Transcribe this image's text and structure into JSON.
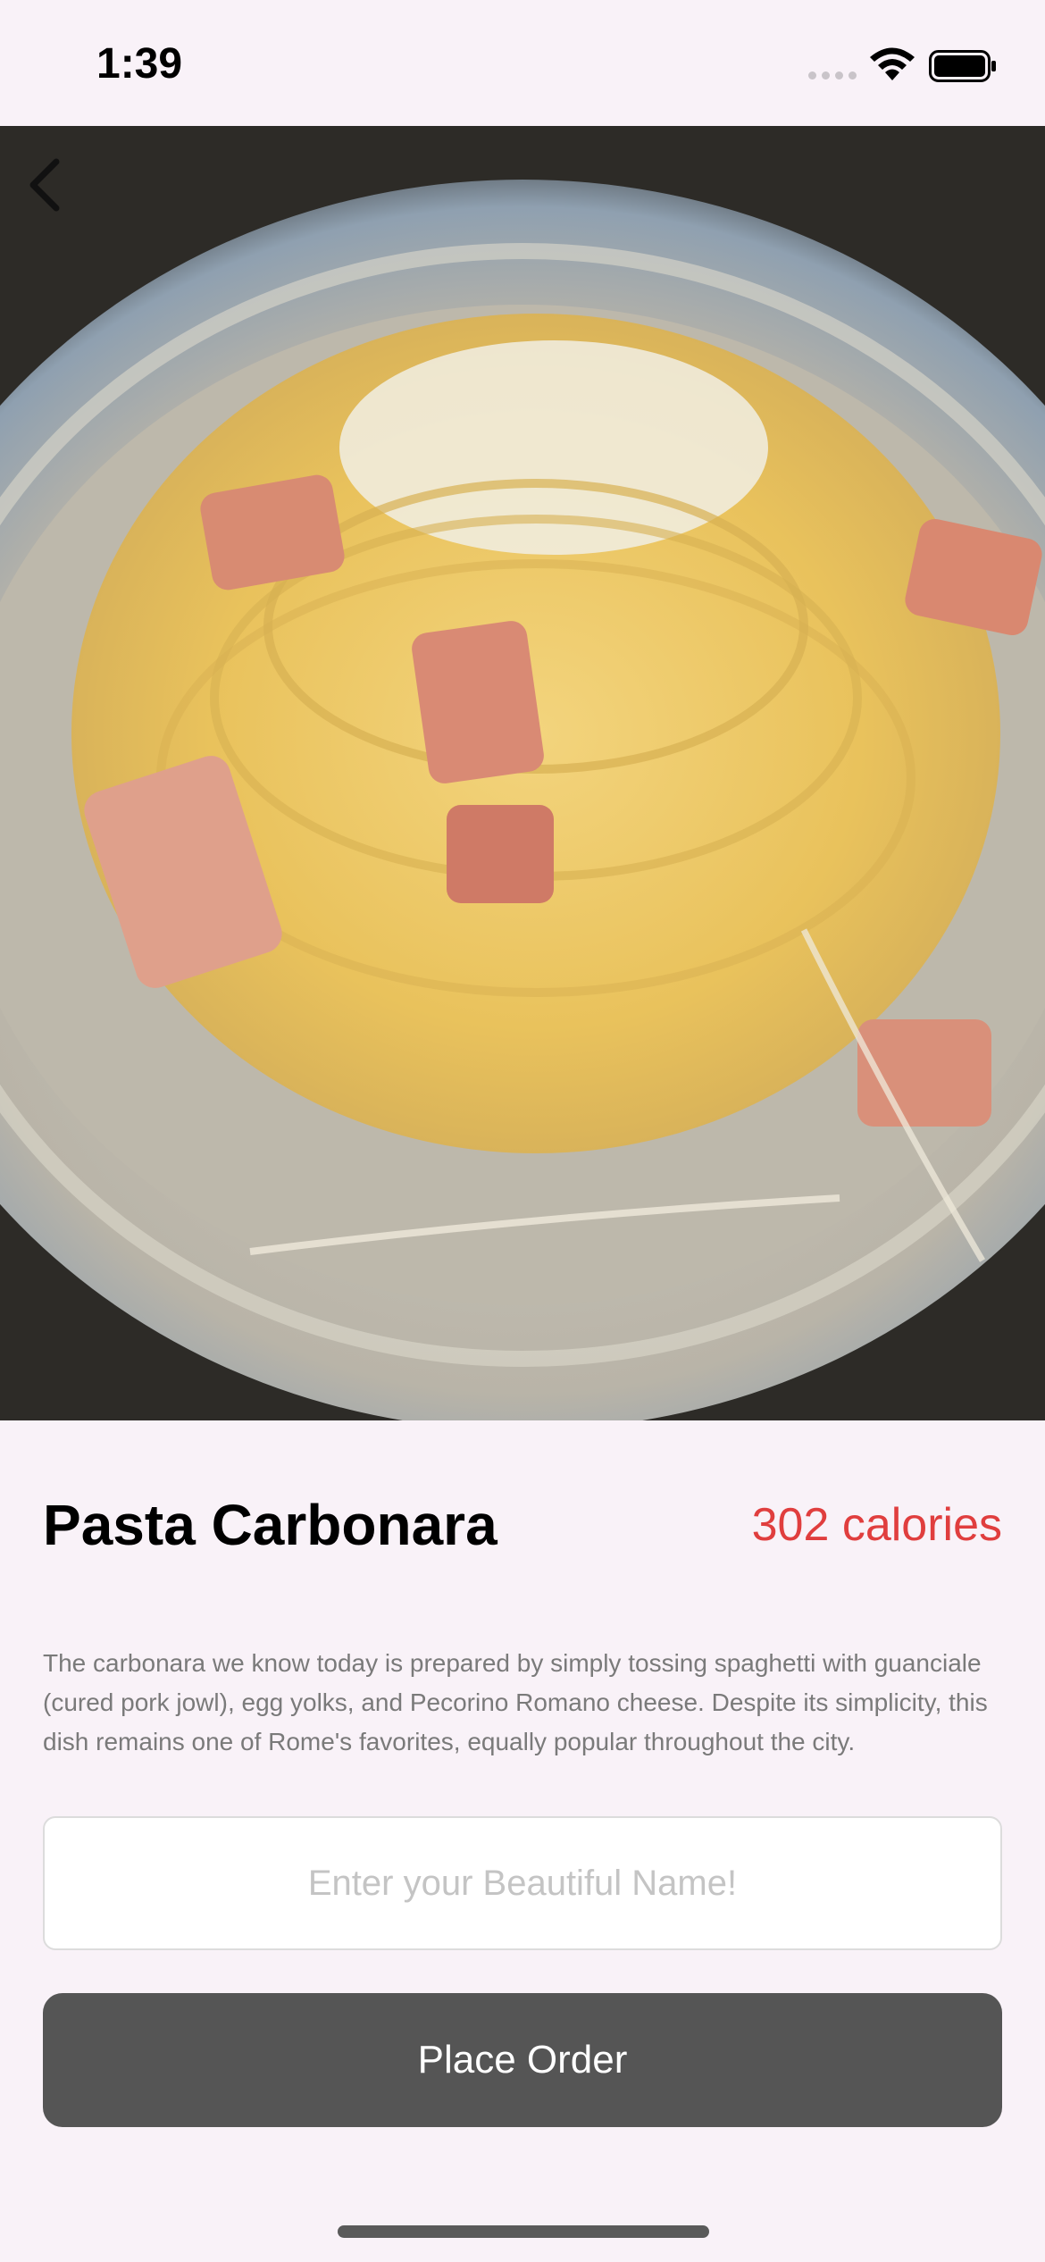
{
  "status_bar": {
    "time": "1:39"
  },
  "hero": {
    "image_subject": "spaghetti-carbonara-plate"
  },
  "dish": {
    "title": "Pasta Carbonara",
    "calories": "302 calories",
    "description": "The carbonara we know today is prepared by simply tossing spaghetti with guanciale (cured pork jowl), egg yolks, and Pecorino Romano cheese. Despite its simplicity, this dish remains one of Rome's favorites, equally popular throughout the city."
  },
  "form": {
    "name_placeholder": "Enter your Beautiful Name!",
    "name_value": "",
    "order_button_label": "Place Order"
  },
  "colors": {
    "background": "#f9f2f8",
    "calories_accent": "#e03e3e",
    "button_bg": "#555555",
    "button_text": "#ffffff"
  },
  "icons": {
    "back": "chevron-left-icon",
    "wifi": "wifi-icon",
    "battery": "battery-icon",
    "signal": "signal-icon"
  }
}
